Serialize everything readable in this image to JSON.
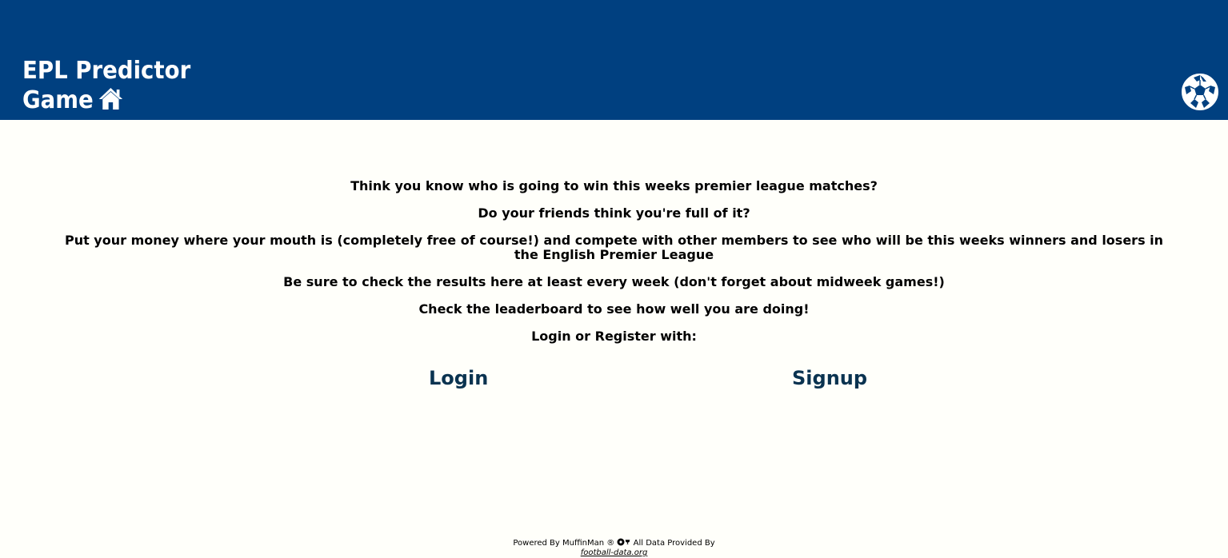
{
  "header": {
    "title_line1": "EPL Predictor",
    "title_line2": "Game",
    "home_icon": "home-icon",
    "ball_icon": "soccer-ball-icon",
    "background_color": "#004080"
  },
  "main": {
    "paragraphs": [
      "Think you know who is going to win this weeks premier league matches?",
      "Do your friends think you're full of it?",
      "Put your money where your mouth is (completely free of course!) and compete with other members to see who will be this weeks winners and losers in the English Premier League",
      "Be sure to check the results here at least every week (don't forget about midweek games!)",
      "Check the leaderboard to see how well you are doing!",
      "Login or Register with:"
    ],
    "login_label": "Login",
    "signup_label": "Signup",
    "link_color": "#0a3350"
  },
  "footer": {
    "powered_text": "Powered By MuffinMan ®",
    "data_text": "All Data Provided By",
    "source_link": "football-data.org"
  }
}
